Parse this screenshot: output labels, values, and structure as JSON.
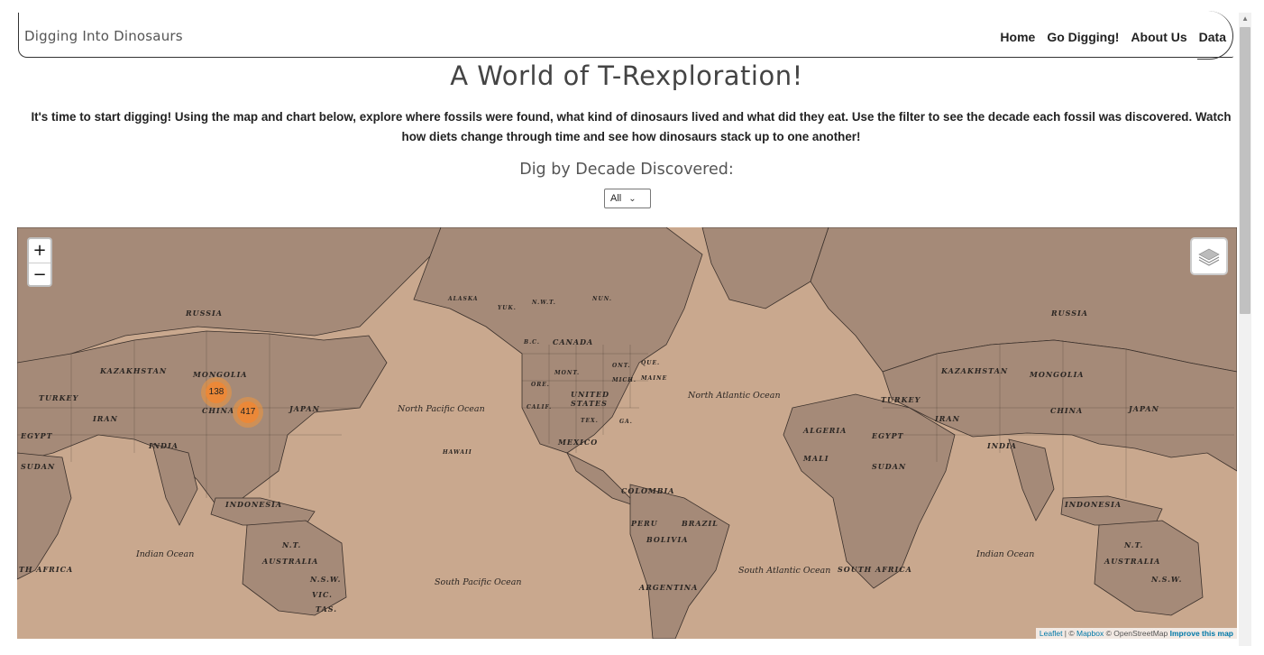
{
  "brand": "Digging Into Dinosaurs",
  "nav": [
    "Home",
    "Go Digging!",
    "About Us",
    "Data"
  ],
  "page_title": "A World of T-Rexploration!",
  "intro": "It's time to start digging! Using the map and chart below, explore where fossils were found, what kind of dinosaurs lived and what did they eat. Use the filter to see the decade each fossil was discovered. Watch how diets change through time and see how dinosaurs stack up to one another!",
  "filter": {
    "label": "Dig by Decade Discovered:",
    "selected": "All"
  },
  "map": {
    "zoom_in": "+",
    "zoom_out": "−",
    "clusters": [
      "138",
      "417"
    ],
    "labels": {
      "russia_w": "RUSSIA",
      "russia_e": "RUSSIA",
      "kazakhstan_w": "KAZAKHSTAN",
      "kazakhstan_e": "KAZAKHSTAN",
      "mongolia_w": "MONGOLIA",
      "mongolia_e": "MONGOLIA",
      "turkey_w": "TURKEY",
      "turkey_e": "TURKEY",
      "iran_w": "IRAN",
      "iran_e": "IRAN",
      "china_w": "CHINA",
      "china_e": "CHINA",
      "japan_w": "JAPAN",
      "japan_e": "JAPAN",
      "egypt_w": "EGYPT",
      "egypt_e": "EGYPT",
      "india_w": "INDIA",
      "india_e": "INDIA",
      "sudan_w": "SUDAN",
      "sudan_e": "SUDAN",
      "indonesia_w": "INDONESIA",
      "indonesia_e": "INDONESIA",
      "australia_w": "AUSTRALIA",
      "australia_e": "AUSTRALIA",
      "nt_w": "N.T.",
      "nt_e": "N.T.",
      "nsw_w": "N.S.W.",
      "nsw_e": "N.S.W.",
      "vic_w": "VIC.",
      "tas_w": "TAS.",
      "south_africa_w": "TH AFRICA",
      "south_africa_e": "SOUTH AFRICA",
      "alaska": "ALASKA",
      "yuk": "YUK.",
      "nwt": "N.W.T.",
      "nun": "NUN.",
      "bc": "B.C.",
      "canada": "CANADA",
      "ont": "ONT.",
      "que": "QUE.",
      "mont": "MONT.",
      "ore": "ORE.",
      "calif": "CALIF.",
      "mich": "MICH.",
      "maine": "MAINE",
      "united_states": "UNITED STATES",
      "tex": "TEX.",
      "ga": "GA.",
      "mexico": "MEXICO",
      "hawaii": "HAWAII",
      "colombia": "COLOMBIA",
      "peru": "PERU",
      "brazil": "BRAZIL",
      "bolivia": "BOLIVIA",
      "argentina": "ARGENTINA",
      "algeria": "ALGERIA",
      "mali": "MALI"
    },
    "oceans": {
      "north_pacific": "North Pacific Ocean",
      "north_atlantic": "North Atlantic Ocean",
      "south_pacific": "South Pacific Ocean",
      "south_atlantic": "South Atlantic Ocean",
      "indian_w": "Indian Ocean",
      "indian_e": "Indian Ocean"
    },
    "attribution": {
      "leaflet": "Leaflet",
      "sep": " | © ",
      "mapbox": "Mapbox",
      "osm": " © OpenStreetMap ",
      "improve": "Improve this map"
    },
    "colors": {
      "water": "#c9a88e",
      "land": "#a58a78",
      "border": "#3a302b"
    }
  }
}
